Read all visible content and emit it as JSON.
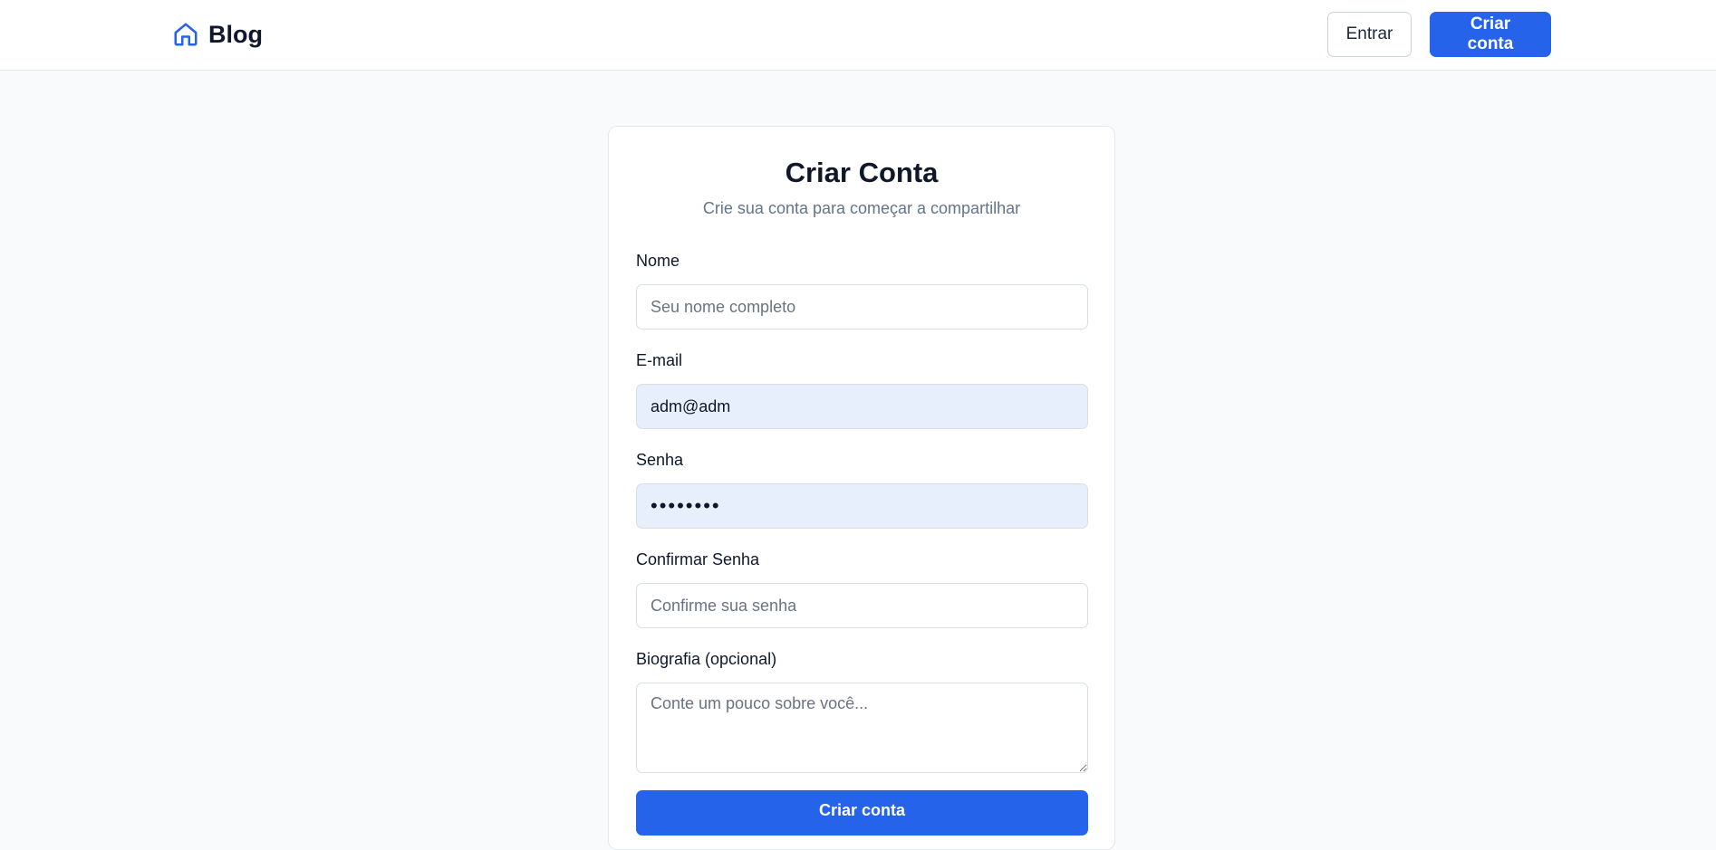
{
  "header": {
    "brand_name": "Blog",
    "brand_icon": "home-icon",
    "login_label": "Entrar",
    "signup_label": "Criar conta"
  },
  "form": {
    "title": "Criar Conta",
    "subtitle": "Crie sua conta para começar a compartilhar",
    "name": {
      "label": "Nome",
      "placeholder": "Seu nome completo",
      "value": ""
    },
    "email": {
      "label": "E-mail",
      "placeholder": "",
      "value": "adm@adm"
    },
    "password": {
      "label": "Senha",
      "value": "••••••••"
    },
    "confirm_password": {
      "label": "Confirmar Senha",
      "placeholder": "Confirme sua senha",
      "value": ""
    },
    "bio": {
      "label": "Biografia (opcional)",
      "placeholder": "Conte um pouco sobre você...",
      "value": ""
    },
    "submit_label": "Criar conta"
  },
  "colors": {
    "accent": "#2563eb",
    "page_background": "#f8fafc",
    "autofill_background": "#e8effc"
  }
}
